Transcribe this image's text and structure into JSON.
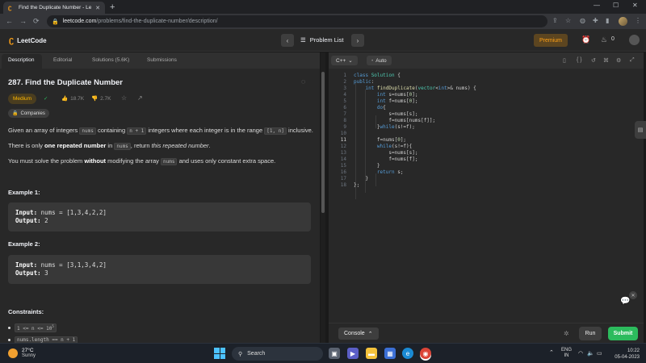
{
  "browser": {
    "tab_title": "Find the Duplicate Number - Lee",
    "url_domain": "leetcode.com",
    "url_path": "/problems/find-the-duplicate-number/description/"
  },
  "header": {
    "logo_text": "LeetCode",
    "problem_list_label": "Problem List",
    "premium_label": "Premium",
    "streak_count": "0"
  },
  "left_tabs": [
    "Description",
    "Editorial",
    "Solutions (5.6K)",
    "Submissions"
  ],
  "problem": {
    "title": "287. Find the Duplicate Number",
    "difficulty": "Medium",
    "likes": "18.7K",
    "dislikes": "2.7K",
    "companies_label": "Companies",
    "p1_a": "Given an array of integers",
    "p1_code1": "nums",
    "p1_b": "containing",
    "p1_code2": "n + 1",
    "p1_c": "integers where each integer is in the range",
    "p1_code3": "[1, n]",
    "p1_d": "inclusive.",
    "p2_a": "There is only",
    "p2_bold": "one repeated number",
    "p2_b": "in",
    "p2_code": "nums",
    "p2_c": ", return",
    "p2_italic": "this repeated number",
    "p2_d": ".",
    "p3_a": "You must solve the problem",
    "p3_bold": "without",
    "p3_b": "modifying the array",
    "p3_code": "nums",
    "p3_c": "and uses only constant extra space.",
    "ex1_title": "Example 1:",
    "ex1_input_label": "Input:",
    "ex1_input": "nums = [1,3,4,2,2]",
    "ex1_output_label": "Output:",
    "ex1_output": "2",
    "ex2_title": "Example 2:",
    "ex2_input_label": "Input:",
    "ex2_input": "nums = [3,1,3,4,2]",
    "ex2_output_label": "Output:",
    "ex2_output": "3",
    "constraints_title": "Constraints:",
    "constraint1_a": "1 <= n <= 10",
    "constraint1_sup": "5",
    "constraint2": "nums.length == n + 1"
  },
  "editor": {
    "language": "C++",
    "mode": "Auto",
    "console_label": "Console",
    "run_label": "Run",
    "submit_label": "Submit",
    "lines": [
      "class Solution {",
      "public:",
      "    int findDuplicate(vector<int>& nums) {",
      "        int s=nums[0];",
      "        int f=nums[0];",
      "        do{",
      "            s=nums[s];",
      "            f=nums[nums[f]];",
      "        }while(s!=f);",
      "",
      "        f=nums[0];",
      "        while(s!=f){",
      "            s=nums[s];",
      "            f=nums[f];",
      "        }",
      "        return s;",
      "    }",
      "};"
    ]
  },
  "taskbar": {
    "temp": "27°C",
    "condition": "Sunny",
    "search_label": "Search",
    "lang1": "ENG",
    "lang2": "IN",
    "time": "10:22",
    "date": "05-04-2023"
  },
  "colors": {
    "accent": "#ffa116",
    "medium": "#ffb800",
    "submit": "#2cbb5d",
    "background": "#282828"
  }
}
